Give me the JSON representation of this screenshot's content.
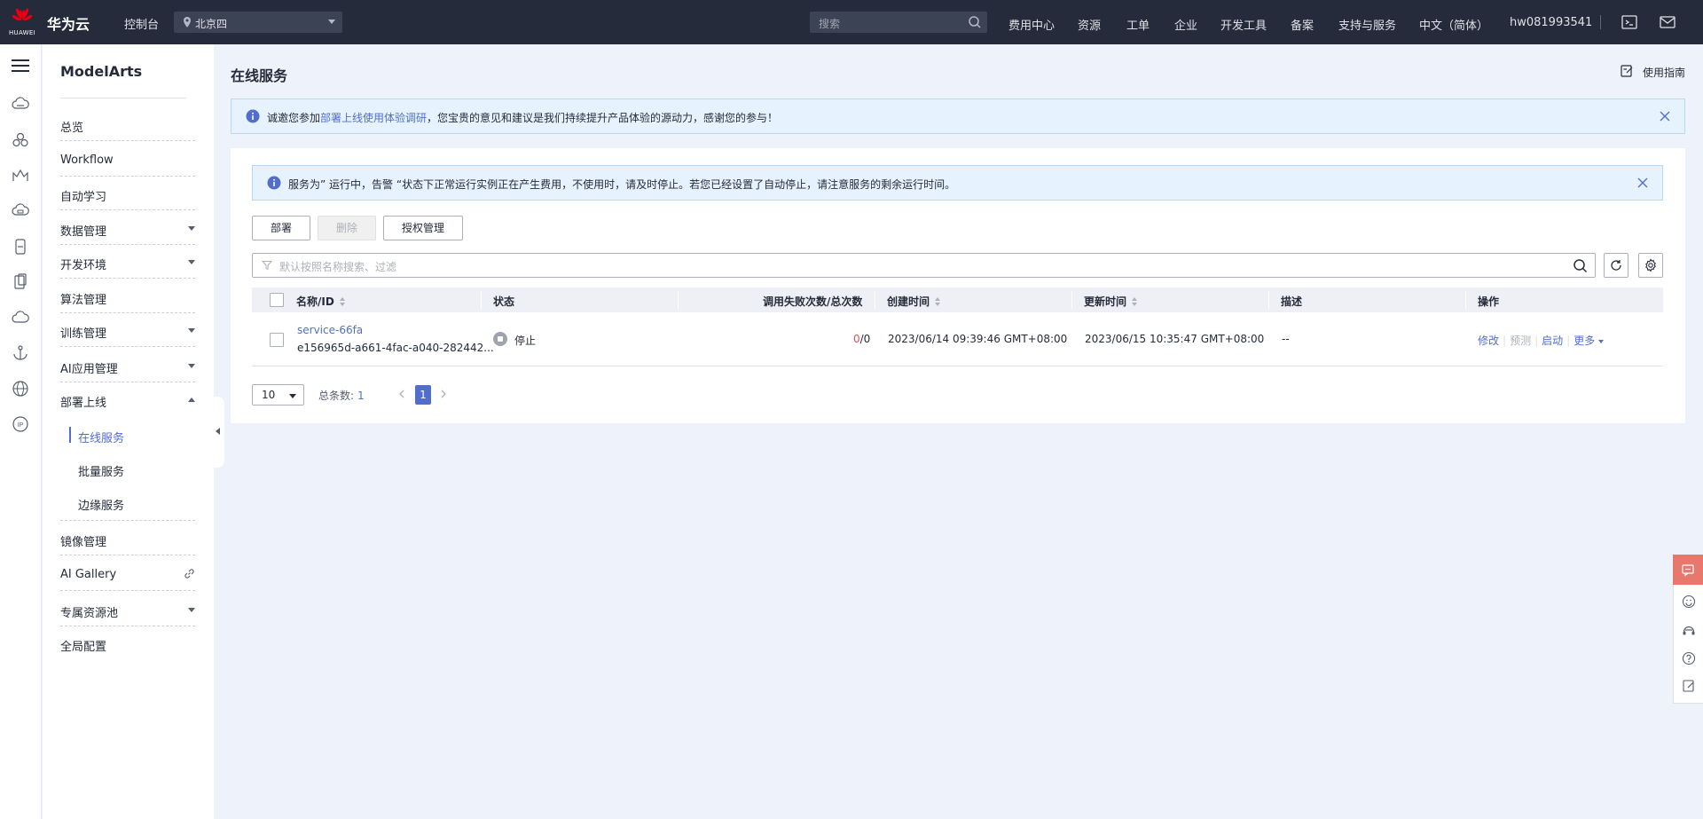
{
  "topbar": {
    "logo_text": "HUAWEI",
    "brand": "华为云",
    "console": "控制台",
    "region": "北京四",
    "search_placeholder": "搜索",
    "nav": [
      "费用中心",
      "资源",
      "工单",
      "企业",
      "开发工具",
      "备案",
      "支持与服务",
      "中文（简体）",
      "hw081993541"
    ]
  },
  "sidebar": {
    "title": "ModelArts",
    "items": [
      {
        "label": "总览"
      },
      {
        "label": "Workflow"
      },
      {
        "label": "自动学习"
      },
      {
        "label": "数据管理"
      },
      {
        "label": "开发环境"
      },
      {
        "label": "算法管理"
      },
      {
        "label": "训练管理"
      },
      {
        "label": "AI应用管理"
      },
      {
        "label": "部署上线"
      },
      {
        "label": "镜像管理"
      },
      {
        "label": "AI Gallery"
      },
      {
        "label": "专属资源池"
      },
      {
        "label": "全局配置"
      }
    ],
    "sub_items": [
      {
        "label": "在线服务"
      },
      {
        "label": "批量服务"
      },
      {
        "label": "边缘服务"
      }
    ]
  },
  "main": {
    "title": "在线服务",
    "guide": "使用指南",
    "notice1": {
      "prefix": "诚邀您参加",
      "link": "部署上线使用体验调研",
      "suffix": "，您宝贵的意见和建议是我们持续提升产品体验的源动力，感谢您的参与！"
    },
    "notice2": "服务为” 运行中，告警 “状态下正常运行实例正在产生费用，不使用时，请及时停止。若您已经设置了自动停止，请注意服务的剩余运行时间。",
    "buttons": {
      "deploy": "部署",
      "delete": "删除",
      "auth": "授权管理"
    },
    "filter_placeholder": "默认按照名称搜索、过滤",
    "table": {
      "headers": {
        "name": "名称/ID",
        "status": "状态",
        "calls": "调用失败次数/总次数",
        "created": "创建时间",
        "updated": "更新时间",
        "desc": "描述",
        "ops": "操作"
      },
      "rows": [
        {
          "name": "service-66fa",
          "id": "e156965d-a661-4fac-a040-282442...",
          "status": "停止",
          "fail": "0",
          "total": "/0",
          "created": "2023/06/14 09:39:46 GMT+08:00",
          "updated": "2023/06/15 10:35:47 GMT+08:00",
          "desc": "--",
          "ops": {
            "modify": "修改",
            "predict": "预测",
            "start": "启动",
            "more": "更多"
          }
        }
      ]
    },
    "pager": {
      "size": "10",
      "total_label": "总条数:",
      "total": "1",
      "page": "1"
    }
  },
  "colors": {
    "topbar": "#252b3a",
    "accent": "#526ecc",
    "notice_bg": "#e6f2fd",
    "float_accent": "#e8776c"
  }
}
